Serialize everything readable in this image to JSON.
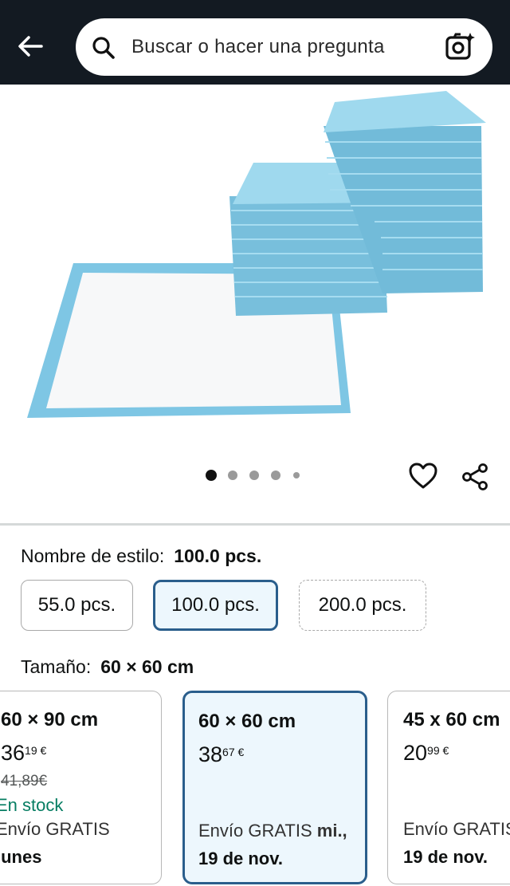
{
  "header": {
    "search_placeholder": "Buscar o hacer una pregunta",
    "icons": [
      "back-arrow-icon",
      "search-icon",
      "camera-search-icon"
    ]
  },
  "gallery": {
    "image_alt": "Empapadores azules y blancos apilados",
    "dots_count": 5,
    "active_dot": 0,
    "icons": [
      "heart-icon",
      "share-icon"
    ]
  },
  "style": {
    "label": "Nombre de estilo:",
    "selected": "100.0 pcs.",
    "options": [
      "55.0 pcs.",
      "100.0 pcs.",
      "200.0 pcs."
    ]
  },
  "size": {
    "label": "Tamaño:",
    "selected": "60 × 60 cm",
    "cards": [
      {
        "title": "60 × 90 cm",
        "price_whole": "36",
        "price_frac": "19 €",
        "old_price": "41,89€",
        "stock": "En stock",
        "shipping": "Envío GRATIS",
        "shipping_day": "lunes"
      },
      {
        "title": "60 × 60 cm",
        "price_whole": "38",
        "price_frac": "67 €",
        "shipping": "Envío GRATIS",
        "shipping_bold": "mi.,",
        "shipping_day": "19 de nov."
      },
      {
        "title": "45 x 60 cm",
        "price_whole": "20",
        "price_frac": "99 €",
        "shipping": "Envío GRATIS",
        "shipping_day": "19 de nov."
      }
    ]
  },
  "colors": {
    "header_bg": "#131a22",
    "selected_border": "#2a5e8c",
    "selected_bg": "#edf7fd",
    "stock_green": "#067d62"
  }
}
